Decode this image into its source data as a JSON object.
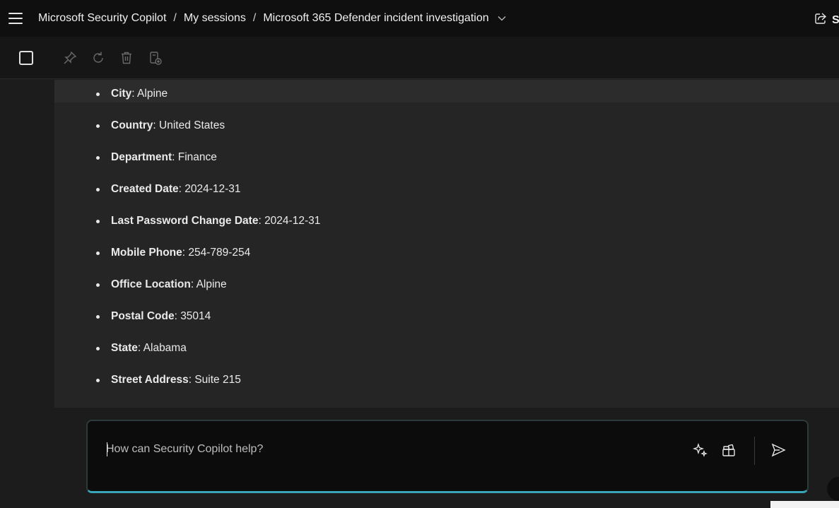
{
  "header": {
    "breadcrumbs": [
      "Microsoft Security Copilot",
      "My sessions",
      "Microsoft 365 Defender incident investigation"
    ],
    "separator": "/",
    "share_label": "S"
  },
  "details": [
    {
      "key": "City",
      "value": ": Alpine"
    },
    {
      "key": "Country",
      "value": ": United States"
    },
    {
      "key": "Department",
      "value": ": Finance"
    },
    {
      "key": "Created Date",
      "value": ": 2024-12-31"
    },
    {
      "key": "Last Password Change Date",
      "value": ": 2024-12-31"
    },
    {
      "key": "Mobile Phone",
      "value": ": 254-789-254"
    },
    {
      "key": "Office Location",
      "value": ": Alpine"
    },
    {
      "key": "Postal Code",
      "value": ": 35014"
    },
    {
      "key": "State",
      "value": ": Alabama"
    },
    {
      "key": "Street Address",
      "value": ": Suite 215"
    }
  ],
  "prompt": {
    "placeholder": "How can Security Copilot help?"
  },
  "icons": {
    "menu": "hamburger-menu-icon",
    "share": "share-icon",
    "pin": "pin-icon",
    "refresh": "refresh-icon",
    "delete": "trash-icon",
    "add_to_pinboard": "pinboard-add-icon",
    "prompt_suggestions": "sparkle-icon",
    "prompts_library": "prompt-book-icon",
    "send": "send-icon"
  },
  "colors": {
    "accent": "#3aa7b8",
    "header_bg": "#0f0f0f",
    "card_bg": "#252525"
  }
}
